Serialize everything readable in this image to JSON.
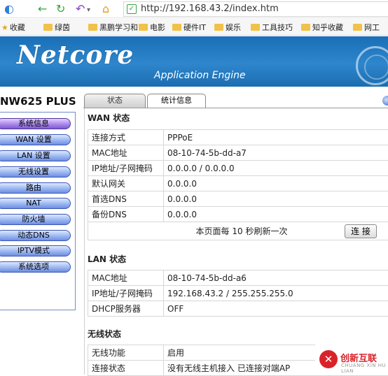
{
  "browser": {
    "url": "http://192.168.43.2/index.htm",
    "bookmarks": [
      "收藏",
      "绿茵",
      "黑鹏学习和",
      "电影",
      "硬件IT",
      "娱乐",
      "工具技巧",
      "知乎收藏",
      "网工"
    ]
  },
  "banner": {
    "logo": "Netcore",
    "subtitle": "Application Engine"
  },
  "sidebar": {
    "model": "NW625 PLUS",
    "items": [
      "系统信息",
      "WAN 设置",
      "LAN 设置",
      "无线设置",
      "路由",
      "NAT",
      "防火墙",
      "动态DNS",
      "IPTV模式",
      "系统选项"
    ],
    "active_index": 0
  },
  "tabs": [
    "状态",
    "统计信息"
  ],
  "wan": {
    "title": "WAN 状态",
    "rows": [
      {
        "k": "连接方式",
        "v": "PPPoE"
      },
      {
        "k": "MAC地址",
        "v": "08-10-74-5b-dd-a7"
      },
      {
        "k": "IP地址/子网掩码",
        "v": "0.0.0.0 / 0.0.0.0"
      },
      {
        "k": "默认网关",
        "v": "0.0.0.0"
      },
      {
        "k": "首选DNS",
        "v": "0.0.0.0"
      },
      {
        "k": "备份DNS",
        "v": "0.0.0.0"
      }
    ],
    "refresh_text": "本页面每 10 秒刷新一次",
    "connect_label": "连 接"
  },
  "lan": {
    "title": "LAN 状态",
    "rows": [
      {
        "k": "MAC地址",
        "v": "08-10-74-5b-dd-a6"
      },
      {
        "k": "IP地址/子网掩码",
        "v": "192.168.43.2 / 255.255.255.0"
      },
      {
        "k": "DHCP服务器",
        "v": "OFF"
      }
    ]
  },
  "wireless": {
    "title": "无线状态",
    "rows": [
      {
        "k": "无线功能",
        "v": "启用"
      },
      {
        "k": "连接状态",
        "v": "没有无线主机接入  已连接对端AP"
      }
    ]
  },
  "watermark": {
    "name": "创新互联",
    "sub": "CHUANG XIN HU LIAN"
  },
  "colors": {
    "banner": "#1a6fb6",
    "menu_button": "#6d8fe0",
    "menu_active": "#7b5bd3"
  }
}
